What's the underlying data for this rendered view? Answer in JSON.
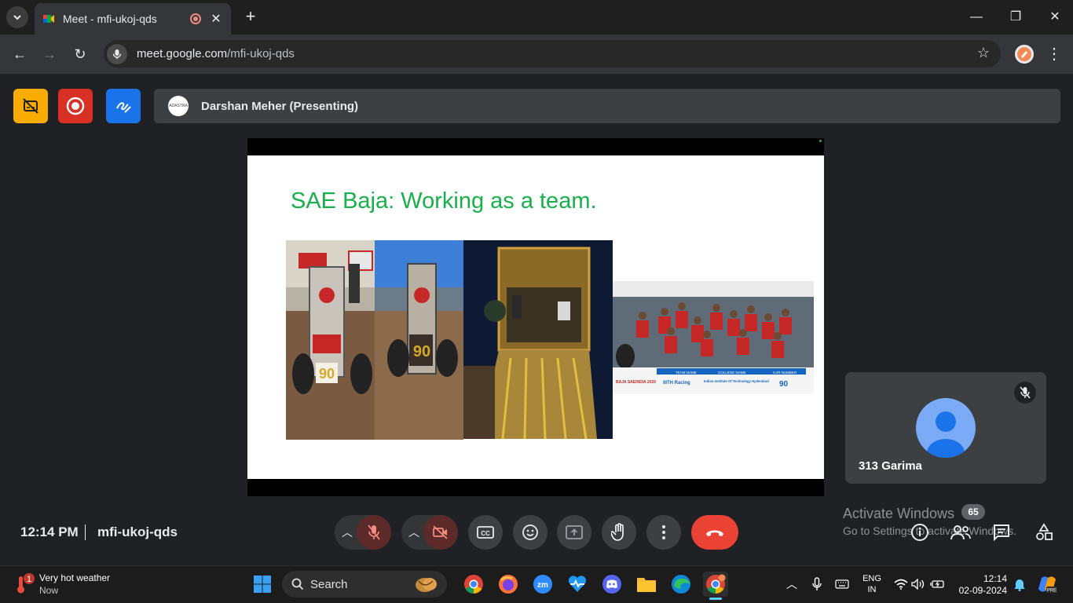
{
  "browser": {
    "tab_title": "Meet - mfi-ukoj-qds",
    "new_tab_symbol": "+",
    "url_host": "meet.google.com",
    "url_path": "/mfi-ukoj-qds"
  },
  "meet": {
    "presenter_avatar_text": "ADASTRA",
    "presenter_label": "Darshan Meher (Presenting)",
    "slide": {
      "title": "SAE Baja: Working as a team.",
      "banner": {
        "team_name_header": "TEAM NAME",
        "college_header": "COLLEGE NAME",
        "car_number_header": "CAR NUMBER",
        "team_name": "IIITH Racing",
        "college": "Indian Institute Of Technology Hyderabad",
        "car_number": "90",
        "event": "BAJA SAEINDIA 2020"
      },
      "car_number_plate": "90"
    },
    "participant_name": "313 Garima",
    "time": "12:14 PM",
    "meeting_code": "mfi-ukoj-qds",
    "people_count": "65",
    "watermark_line1": "Activate Windows",
    "watermark_line2": "Go to Settings to activate Windows."
  },
  "taskbar": {
    "weather_title": "Very hot weather",
    "weather_sub": "Now",
    "weather_badge": "1",
    "search_label": "Search",
    "lang_line1": "ENG",
    "lang_line2": "IN",
    "clock_time": "12:14",
    "clock_date": "02-09-2024"
  },
  "colors": {
    "hangup": "#ea4335",
    "slide_title": "#18b04a",
    "rec_button": "#d93025",
    "whiteboard_button": "#1a73e8",
    "captions_button": "#f9ab00"
  }
}
